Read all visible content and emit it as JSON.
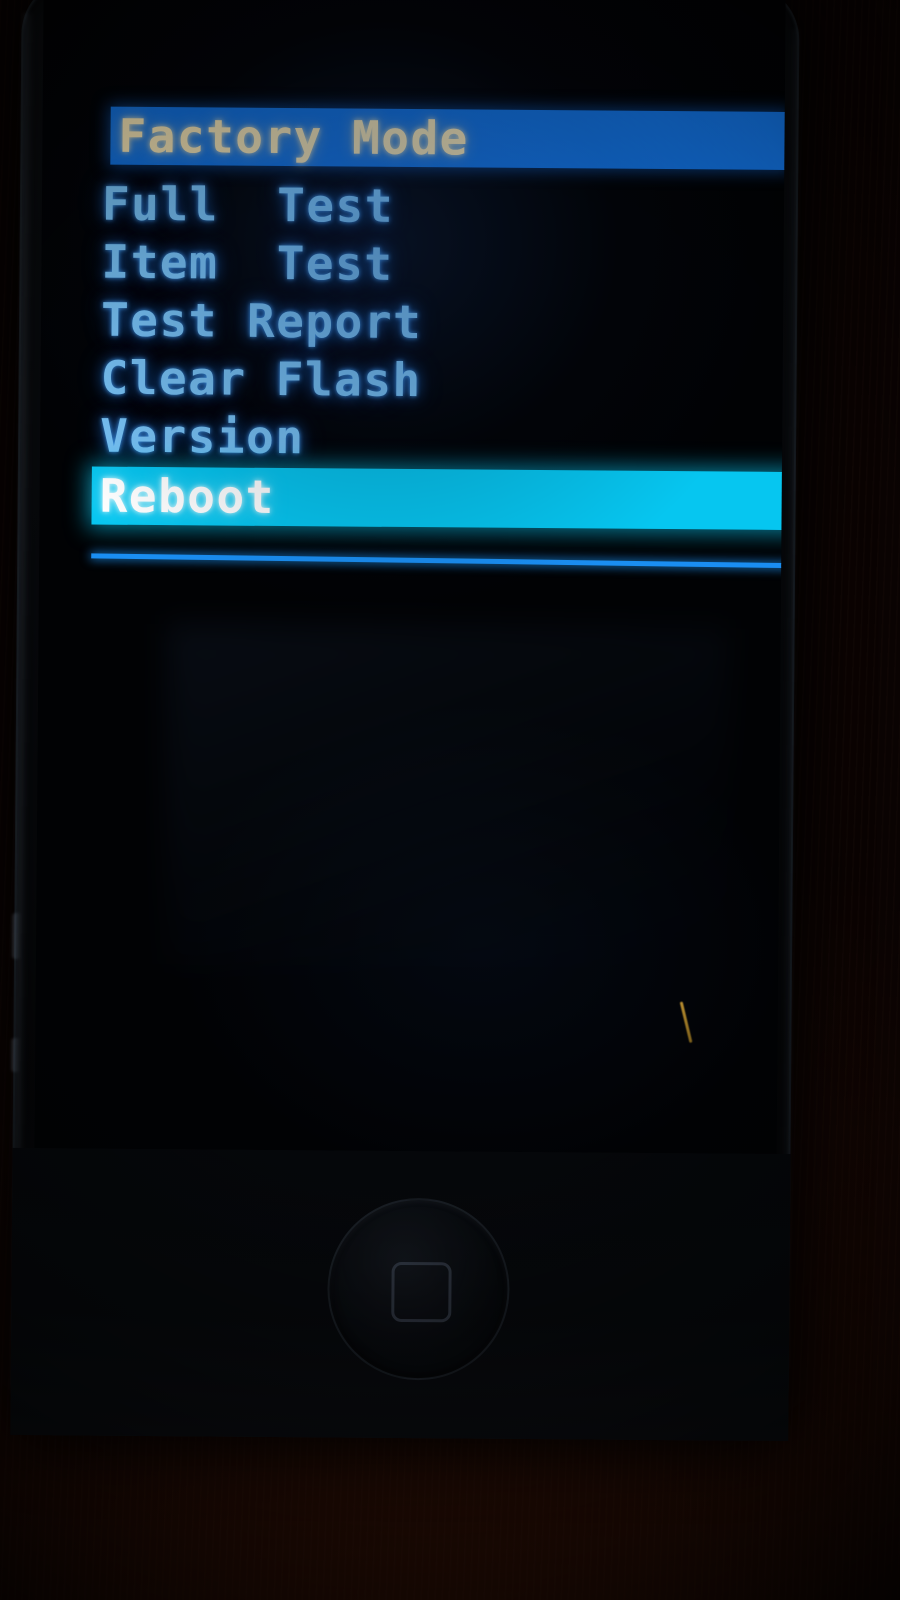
{
  "device": {
    "label": "smartphone",
    "earpiece": "earpiece-speaker",
    "camera": "front-camera",
    "home_button": "home-button"
  },
  "screen": {
    "mode_title": "Factory Mode",
    "background_color": "#010204"
  },
  "menu": {
    "title": {
      "label": "Factory Mode",
      "text_color": "#f7e6b4",
      "background_color": "#1272e0"
    },
    "items": [
      {
        "label": "Full  Test",
        "selected": false,
        "text_color": "#7ac5f8"
      },
      {
        "label": "Item  Test",
        "selected": false,
        "text_color": "#7ac5f8"
      },
      {
        "label": "Test Report",
        "selected": false,
        "text_color": "#7ac5f8"
      },
      {
        "label": "Clear Flash",
        "selected": false,
        "text_color": "#7ac5f8"
      },
      {
        "label": "Version",
        "selected": false,
        "text_color": "#7ac5f8"
      },
      {
        "label": "Reboot",
        "selected": true,
        "text_color": "#ffffff",
        "background_color": "#06c6f0"
      }
    ],
    "divider_color": "#1a8ef2",
    "selected_index": 5
  },
  "surroundings": {
    "surface": "wooden-table",
    "surface_color": "#301005",
    "debris": "hair-strand"
  }
}
